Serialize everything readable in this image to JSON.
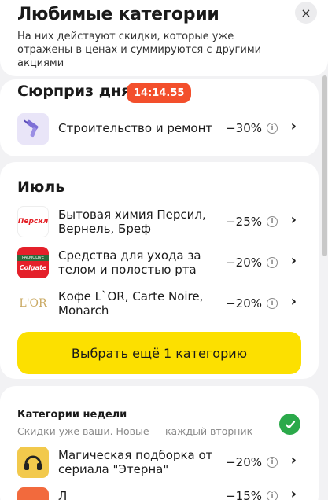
{
  "header": {
    "title": "Любимые категории",
    "subtitle": "На них действуют скидки, которые уже отражены в ценах и суммируются с другими акциями",
    "close_icon": "×"
  },
  "surprise": {
    "title": "Сюрприз дня",
    "timer": "14:14.55",
    "item": {
      "label": "Строительство и ремонт",
      "discount": "−30%",
      "icon": "drill-icon"
    }
  },
  "july": {
    "title": "Июль",
    "items": [
      {
        "label": "Бытовая химия Персил, Вернель, Бреф",
        "discount": "−25%",
        "icon": "persil-logo",
        "logo_text": "Персил"
      },
      {
        "label": "Средства для ухода за телом и полостью рта",
        "discount": "−20%",
        "icon": "colgate-logo",
        "logo_text": "Colgate",
        "logo_text2": "PALMOLIVE"
      },
      {
        "label": "Кофе L`OR, Carte Noire, Monarch",
        "discount": "−20%",
        "icon": "lor-logo",
        "logo_text": "L'OR"
      }
    ],
    "cta": "Выбрать ещё 1 категорию"
  },
  "week": {
    "title": "Категории недели",
    "subtitle": "Скидки уже ваши. Новые — каждый вторник",
    "items": [
      {
        "label": "Магическая подборка от сериала \"Этерна\"",
        "discount": "−20%",
        "icon": "headphones-icon"
      },
      {
        "label": "Л",
        "discount": "−15%",
        "icon": "product-icon"
      }
    ]
  },
  "colors": {
    "accent_yellow": "#fce000",
    "timer_red": "#f34f2c",
    "check_green": "#2ba94a"
  }
}
